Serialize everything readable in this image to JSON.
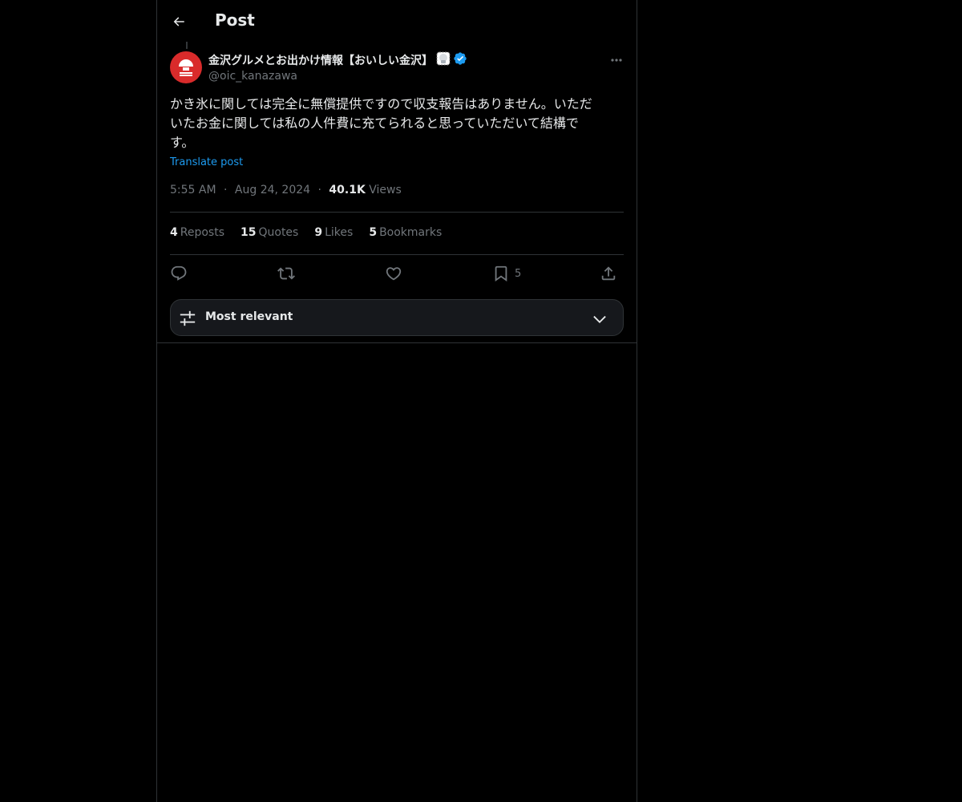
{
  "header": {
    "title": "Post",
    "back_icon": "arrow-left-icon"
  },
  "author": {
    "display_name": "金沢グルメとお出かけ情報【おいしい金沢】",
    "handle": "@oic_kanazawa",
    "avatar_color": "#d92b2b",
    "verified_color": "#1d9bf0",
    "emoji_icon": "shaved-ice-emoji-icon"
  },
  "post": {
    "text": "かき氷に関しては完全に無償提供ですので収支報告はありません。いただ\nいたお金に関しては私の人件費に充てられると思っていただいて結構で\nす。",
    "translate_label": "Translate post",
    "time": "5:55 AM",
    "date": "Aug 24, 2024",
    "separator": "·",
    "views_count": "40.1K",
    "views_label": "Views"
  },
  "stats": [
    {
      "count": "4",
      "label": "Reposts"
    },
    {
      "count": "15",
      "label": "Quotes"
    },
    {
      "count": "9",
      "label": "Likes"
    },
    {
      "count": "5",
      "label": "Bookmarks"
    }
  ],
  "actions": {
    "reply_icon": "reply-icon",
    "repost_icon": "repost-icon",
    "like_icon": "heart-icon",
    "bookmark_icon": "bookmark-icon",
    "bookmark_count": "5",
    "share_icon": "share-icon"
  },
  "sort": {
    "label": "Most relevant",
    "icon": "sliders-icon",
    "chevron": "chevron-down-icon"
  },
  "colors": {
    "background": "#000000",
    "text": "#e7e9ea",
    "muted": "#71767b",
    "border": "#2f3336",
    "link": "#1d9bf0"
  }
}
